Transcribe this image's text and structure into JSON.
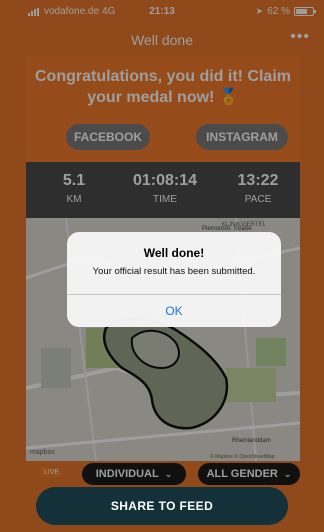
{
  "status_bar": {
    "carrier": "vodafone.de",
    "network": "4G",
    "time": "21:13",
    "battery": "62 %"
  },
  "nav": {
    "title": "Well done",
    "more": "•••"
  },
  "congrats": {
    "text": "Congratulations, you did it!  Claim your medal now! 🏅"
  },
  "social": {
    "facebook": "FACEBOOK",
    "instagram": "INSTAGRAM"
  },
  "stats": [
    {
      "value": "5.1",
      "unit": "KM"
    },
    {
      "value": "01:08:14",
      "unit": "TIME"
    },
    {
      "value": "13:22",
      "unit": "PACE"
    }
  ],
  "map": {
    "street_labels": [
      "Piemontstr. Straße",
      "Rheinlanddam"
    ],
    "area_label": "KLINIKVIERTEL",
    "attribution": "© Mapbox © OpenStreetMap",
    "logo": "mapbox"
  },
  "filters": {
    "live": "LIVE",
    "individual": "INDIVIDUAL",
    "gender": "ALL GENDER"
  },
  "share_button": "SHARE TO FEED",
  "alert": {
    "title": "Well done!",
    "message": "Your official result has been submitted.",
    "ok": "OK"
  },
  "colors": {
    "accent_orange": "#e8762a",
    "share_button_bg": "#14313a",
    "alert_button": "#1a73e8"
  }
}
